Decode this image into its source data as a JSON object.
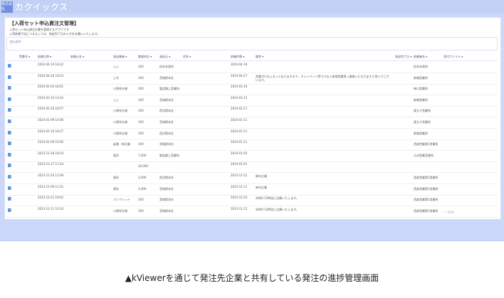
{
  "header": {
    "logo_text": "カクイックス",
    "logo_small": "株式会社"
  },
  "panel": {
    "title": "【入荷セット申込資注文管理】",
    "description_line1": "入荷セット申込資注文書を管理するアプリです",
    "description_line2": "入荷依頼下記につきましては、発送完了日の入力をお願いいたします。",
    "search_label": "絞込条件"
  },
  "table": {
    "columns": [
      "受番号",
      "依頼日時",
      "依頼元名",
      "発送業者",
      "数量合計",
      "発送元",
      "住所",
      "依頼件数",
      "備考",
      "発送完了日",
      "依頼者名",
      "添付ファイル"
    ],
    "rows": [
      {
        "date": "2024-04-19 18:22",
        "type": "上入",
        "qty": "200",
        "origin": "松本本発所",
        "req": "2024-04-19",
        "note": "",
        "person": "松本本発所"
      },
      {
        "date": "2024-04-26 18:53",
        "type": "上半",
        "qty": "200",
        "origin": "宮城県本社",
        "req": "2024-04-27",
        "note": "営業が少なくなっておりますので、キャンペーン等で少なく新規営業等へ連絡いただけますと幸いでございます。",
        "person": "新城営業所"
      },
      {
        "date": "2024-03-04 18:01",
        "type": "川原伴仕様",
        "qty": "300",
        "origin": "製造業上宮業所",
        "req": "2024-03-16",
        "note": "",
        "person": "神川営業所"
      },
      {
        "date": "2024-03-10 14:43",
        "type": "上入",
        "qty": "100",
        "origin": "宮城県本社",
        "req": "2024-03-15",
        "note": "",
        "person": "新城営業所"
      },
      {
        "date": "2024-02-26 18:57",
        "type": "川原伴仕様",
        "qty": "200",
        "origin": "西洋県本社",
        "req": "2024-02-27",
        "note": "",
        "person": "東九介営業所"
      },
      {
        "date": "2024-01-09 14:06",
        "type": "川原伴仕様",
        "qty": "100",
        "origin": "宮城県本社",
        "req": "2024-01-11",
        "note": "",
        "person": "東九介営業所"
      },
      {
        "date": "2024-01-10 18:17",
        "type": "川原伴仕様",
        "qty": "100",
        "origin": "西洋県本社",
        "req": "2024-01-11",
        "note": "",
        "person": "新城営業所"
      },
      {
        "date": "2024-01-09 10:00",
        "type": "延着・新光業",
        "qty": "100",
        "origin": "宮城県本社",
        "req": "2024-01-11",
        "note": "",
        "person": "西部営業第1営業所"
      },
      {
        "date": "2023-12-28 18:54",
        "type": "東洋",
        "qty": "7,000",
        "origin": "製造業上宮業所",
        "req": "2024-01-05",
        "note": "",
        "person": "九州営業宮業所"
      },
      {
        "date": "2023-12-27 11:54",
        "type": "",
        "qty": "20,000",
        "origin": "",
        "req": "2024-01-01",
        "note": "",
        "person": ""
      },
      {
        "date": "2023-12-20 11:09",
        "type": "東伴",
        "qty": "3,000",
        "origin": "西洋県本社",
        "req": "2023-12-22",
        "note": "新年企業",
        "person": "西部営業第1営業所"
      },
      {
        "date": "2023-12-09 11:22",
        "type": "東伴",
        "qty": "3,000",
        "origin": "宮城県本社",
        "req": "2023-12-11",
        "note": "新年企業",
        "person": "西部営業第1営業所"
      },
      {
        "date": "2023-12-21 18:42",
        "type": "パンフレット",
        "qty": "500",
        "origin": "宮城県本社",
        "req": "2023-12-22",
        "note": "年明け13時迄に出庫いたします。",
        "person": "西部営業第1営業所"
      },
      {
        "date": "2023-12-11 10:33",
        "type": "川原伴仕様",
        "qty": "500",
        "origin": "宮城県本社",
        "req": "2023-12-12",
        "note": "年明け13時迄に出庫いたします。",
        "person": "西部営業第1営業所"
      }
    ],
    "tail_label": "- ~ 1/10"
  },
  "caption": "▲kViewerを通じて発注先企業と共有している発注の進捗管理画面"
}
